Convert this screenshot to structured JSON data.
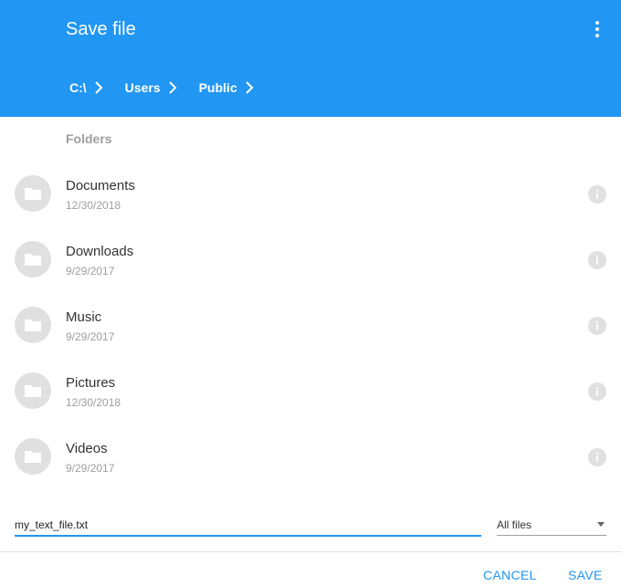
{
  "header": {
    "title": "Save file",
    "menu_icon": "more-vert-icon",
    "breadcrumb": [
      "C:\\",
      "Users",
      "Public"
    ],
    "color": "#2196f3"
  },
  "folders": {
    "label": "Folders",
    "items": [
      {
        "name": "Documents",
        "date": "12/30/2018"
      },
      {
        "name": "Downloads",
        "date": "9/29/2017"
      },
      {
        "name": "Music",
        "date": "9/29/2017"
      },
      {
        "name": "Pictures",
        "date": "12/30/2018"
      },
      {
        "name": "Videos",
        "date": "9/29/2017"
      }
    ]
  },
  "footer": {
    "filename": "my_text_file.txt",
    "filter": "All files",
    "cancel_label": "CANCEL",
    "save_label": "SAVE"
  }
}
